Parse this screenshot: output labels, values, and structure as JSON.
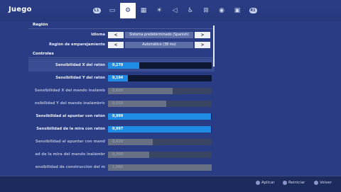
{
  "header": {
    "title": "Juego"
  },
  "tabs": [
    {
      "name": "l1-badge",
      "kind": "pill",
      "glyph": "L1"
    },
    {
      "name": "monitor-icon",
      "glyph": "▭"
    },
    {
      "name": "gear-icon",
      "glyph": "⚙",
      "selected": true
    },
    {
      "name": "grid-icon",
      "glyph": "▦"
    },
    {
      "name": "brightness-icon",
      "glyph": "☀"
    },
    {
      "name": "speaker-icon",
      "glyph": "◁"
    },
    {
      "name": "accessibility-icon",
      "glyph": "♿"
    },
    {
      "name": "network-icon",
      "glyph": "⊞"
    },
    {
      "name": "gamepad-icon",
      "glyph": "◉"
    },
    {
      "name": "controller-icon",
      "glyph": "▣"
    },
    {
      "name": "r1-badge",
      "kind": "pill",
      "glyph": "R1"
    }
  ],
  "sections": {
    "region": "Región",
    "controls": "Controles"
  },
  "region_rows": [
    {
      "label": "Idioma",
      "value": "Sistema predeterminado (Spanish)",
      "left": "<",
      "right": ">"
    },
    {
      "label": "Región de emparejamiento",
      "value": "Automático (38 ms)",
      "left": "<",
      "right": ">"
    }
  ],
  "control_rows": [
    {
      "label": "Sensibilidad X del ratón",
      "value": "0,278",
      "fill": 0.3,
      "dim": false
    },
    {
      "label": "Sensibilidad Y del ratón",
      "value": "0,194",
      "fill": 0.19,
      "dim": false
    },
    {
      "label": "Sensibilidad X del mando inalámb",
      "value": "0,600",
      "fill": 0.62,
      "dim": true
    },
    {
      "label": "nsibilidad Y del mando inalámbric",
      "value": "0,550",
      "fill": 0.56,
      "dim": true
    },
    {
      "label": "Sensibilidad al apuntar con ratón",
      "value": "0,999",
      "fill": 0.995,
      "dim": false
    },
    {
      "label": "Sensibilidad de la mira con ratón",
      "value": "0,997",
      "fill": 0.993,
      "dim": false
    },
    {
      "label": "Sensibilidad al apuntar con mand",
      "value": "0,420",
      "fill": 0.43,
      "dim": true
    },
    {
      "label": "ad de la mira del mando inalámbr",
      "value": "0,390",
      "fill": 0.4,
      "dim": true
    },
    {
      "label": "ensibilidad de construcción del m",
      "value": "1,000",
      "fill": 1.0,
      "dim": true
    }
  ],
  "footer": {
    "apply": "Aplicar",
    "reset": "Reiniciar",
    "back": "Volver"
  },
  "colors": {
    "accent": "#1f8ce6",
    "background": "#2a3d84"
  }
}
